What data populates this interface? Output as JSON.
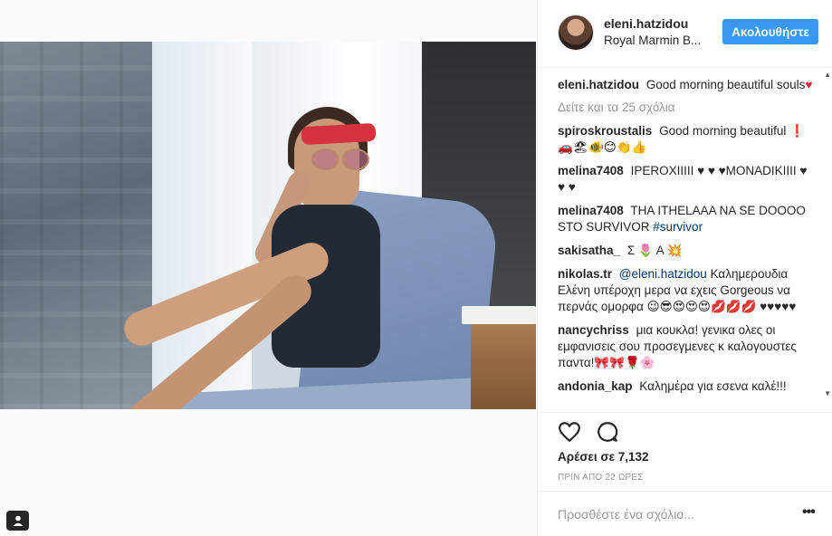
{
  "post": {
    "photo_alt": "photo"
  },
  "header": {
    "username": "eleni.hatzidou",
    "location": "Royal Marmin B...",
    "follow_label": "Ακολουθήστε"
  },
  "caption": {
    "username": "eleni.hatzidou",
    "text": "Good morning beautiful souls",
    "emoji": "♥"
  },
  "view_all_comments": "Δείτε και τα 25 σχόλια",
  "comments": [
    {
      "user": "spiroskroustalis",
      "text": "Good morning beautiful ❗️🚗🏖🐠😊👏👍"
    },
    {
      "user": "melina7408",
      "text": "IPEROXIIIII ♥ ♥ ♥MONADIKIIII ♥ ♥ ♥"
    },
    {
      "user": "melina7408",
      "text": "THA ITHELAAA NA SE DOOOO STO SURVIVOR",
      "hashtag": "#survivor"
    },
    {
      "user": "sakisatha_",
      "text": "Σ 🌷 Α 💥"
    },
    {
      "user": "nikolas.tr",
      "mention": "@eleni.hatzidou",
      "text": "Καλημερουδια Ελένη υπέροχη μερα να εχεις Gorgeous να περνάς ομορφα 😉😎😍😍😍💋💋💋 ♥♥♥♥♥"
    },
    {
      "user": "nancychriss",
      "text": "μια κουκλα! γενικα ολες οι εμφανισεις σου προσεγμενες κ καλογουστες παντα!🎀🎀🌹🌸"
    },
    {
      "user": "andonia_kap",
      "text": "Καλημέρα για εσενα καλέ!!!"
    }
  ],
  "likes": "Αρέσει σε 7,132",
  "timestamp": "ΠΡΙΝ ΑΠΟ 22 ΩΡΕΣ",
  "add_comment_placeholder": "Προσθέστε ένα σχόλιο...",
  "more_label": "•••",
  "colors": {
    "accent": "#3897f0",
    "text": "#262626",
    "muted": "#999999",
    "link": "#003569",
    "heart": "#e02b3e"
  },
  "icons": {
    "like": "heart-outline-icon",
    "comment": "speech-bubble-icon",
    "user_tag": "person-tag-icon"
  }
}
